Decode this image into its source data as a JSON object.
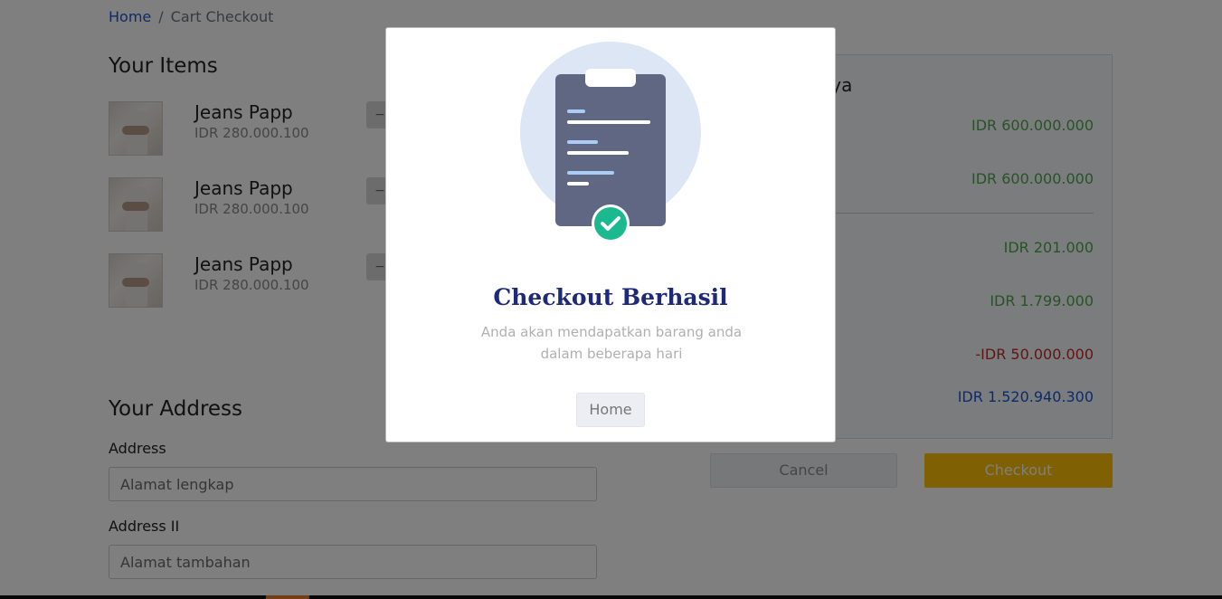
{
  "breadcrumb": {
    "home": "Home",
    "separator": "/",
    "current": "Cart Checkout"
  },
  "items_section": {
    "title": "Your Items",
    "items": [
      {
        "name": "Jeans Papp",
        "price": "IDR 280.000.100"
      },
      {
        "name": "Jeans Papp",
        "price": "IDR 280.000.100"
      },
      {
        "name": "Jeans Papp",
        "price": "IDR 280.000.100"
      }
    ]
  },
  "address_section": {
    "title": "Your Address",
    "address_label": "Address",
    "address_placeholder": "Alamat lengkap",
    "address2_label": "Address II",
    "address2_placeholder": "Alamat tambahan"
  },
  "summary": {
    "title_visible": "aya",
    "rows": [
      {
        "value": "IDR 600.000.000",
        "color": "#4fa64f"
      },
      {
        "value": "IDR 600.000.000",
        "color": "#4fa64f"
      },
      {
        "value": "IDR 201.000",
        "color": "#4fa64f"
      },
      {
        "value": "IDR 1.799.000",
        "color": "#4fa64f"
      },
      {
        "value": "-IDR 50.000.000",
        "color": "#c62828"
      },
      {
        "value": "IDR 1.520.940.300",
        "color": "#1a56d6"
      }
    ]
  },
  "actions": {
    "cancel_label": "Cancel",
    "checkout_label": "Checkout"
  },
  "modal": {
    "title": "Checkout Berhasil",
    "subtitle": "Anda akan mendapatkan barang anda dalam beberapa hari",
    "home_label": "Home",
    "illustration_icon": "clipboard-check-icon"
  },
  "colors": {
    "modal_title": "#1e2a78",
    "checkout_button": "#ffc107",
    "success_check": "#1bb98f",
    "clipboard": "#5f6782",
    "illustration_circle": "#dde6f5"
  }
}
